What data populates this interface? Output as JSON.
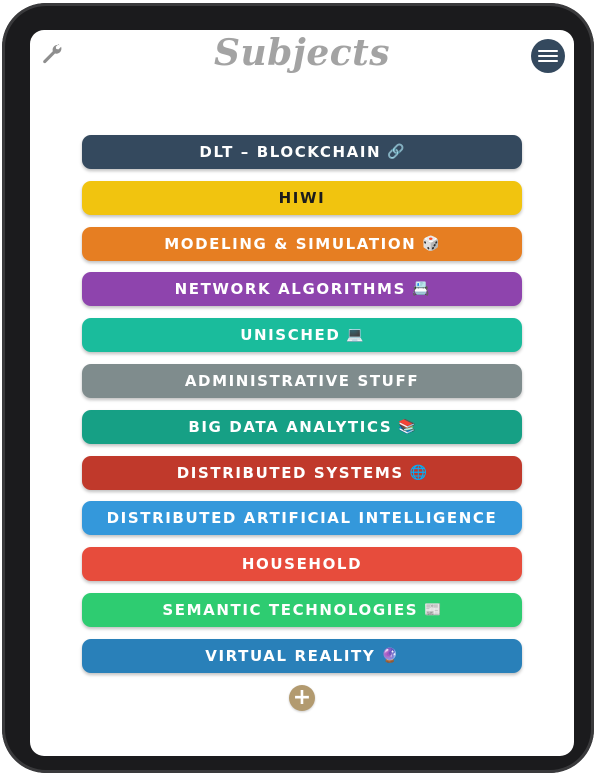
{
  "header": {
    "title": "Subjects",
    "settings_icon": "wrench-icon",
    "menu_icon": "hamburger-menu-icon"
  },
  "subjects": [
    {
      "label": "DLT – BLOCKCHAIN",
      "emoji": "🔗",
      "color": "#34495e"
    },
    {
      "label": "HIWI",
      "emoji": "",
      "color": "#f1c40f"
    },
    {
      "label": "MODELING & SIMULATION",
      "emoji": "🎲",
      "color": "#e67e22"
    },
    {
      "label": "NETWORK ALGORITHMS",
      "emoji": "📇",
      "color": "#8e44ad"
    },
    {
      "label": "UNISCHED",
      "emoji": "💻",
      "color": "#1abc9c"
    },
    {
      "label": "ADMINISTRATIVE STUFF",
      "emoji": "",
      "color": "#7f8c8d"
    },
    {
      "label": "BIG DATA ANALYTICS",
      "emoji": "📚",
      "color": "#16a085"
    },
    {
      "label": "DISTRIBUTED SYSTEMS",
      "emoji": "🌐",
      "color": "#c0392b"
    },
    {
      "label": "DISTRIBUTED ARTIFICIAL INTELLIGENCE",
      "emoji": "",
      "color": "#3498db"
    },
    {
      "label": "HOUSEHOLD",
      "emoji": "",
      "color": "#e74c3c"
    },
    {
      "label": "SEMANTIC TECHNOLOGIES",
      "emoji": "📰",
      "color": "#2ecc71"
    },
    {
      "label": "VIRTUAL REALITY",
      "emoji": "🔮",
      "color": "#2980b9"
    }
  ],
  "add_button": {
    "label": "+",
    "color": "#b29a6f"
  }
}
